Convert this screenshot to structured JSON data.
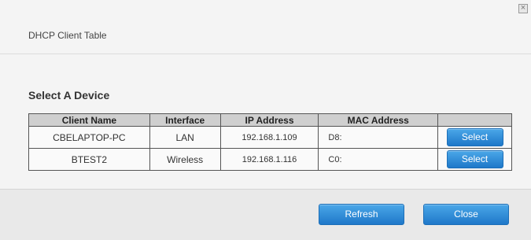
{
  "dialog": {
    "title": "DHCP Client Table",
    "close_icon": "close-icon"
  },
  "section": {
    "title": "Select A Device"
  },
  "table": {
    "columns": [
      "Client Name",
      "Interface",
      "IP Address",
      "MAC Address",
      ""
    ],
    "rows": [
      {
        "client_name": "CBELAPTOP-PC",
        "interface": "LAN",
        "ip": "192.168.1.109",
        "mac": "D8:",
        "action": "Select"
      },
      {
        "client_name": "BTEST2",
        "interface": "Wireless",
        "ip": "192.168.1.116",
        "mac": "C0:",
        "action": "Select"
      }
    ]
  },
  "footer": {
    "refresh_label": "Refresh",
    "close_label": "Close"
  },
  "colors": {
    "button_blue": "#2a86d6",
    "header_bg": "#cfcfcf"
  }
}
